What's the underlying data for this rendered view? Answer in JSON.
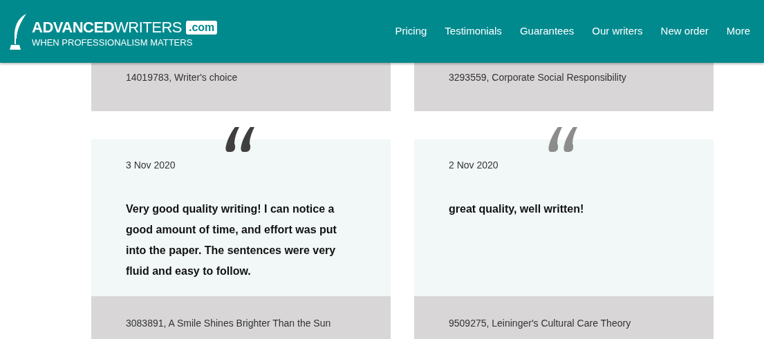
{
  "logo": {
    "name_bold": "ADVANCED",
    "name_light": "WRITERS",
    "domain": ".com",
    "tagline": "WHEN PROFESSIONALISM MATTERS"
  },
  "nav": [
    "Pricing",
    "Testimonials",
    "Guarantees",
    "Our writers",
    "New order",
    "More"
  ],
  "columns": [
    {
      "previous_order": "14019783, Writer's choice",
      "review": {
        "quote_active": true,
        "date": "3 Nov 2020",
        "text": "Very good quality writing! I can notice a good amount of time, and effort was put into the paper. The sentences were very fluid and easy to follow.",
        "order": "3083891, A Smile Shines Brighter Than the Sun"
      }
    },
    {
      "previous_order": "3293559, Corporate Social Responsibility",
      "review": {
        "quote_active": false,
        "date": "2 Nov 2020",
        "text": "great quality, well written!",
        "order": "9509275, Leininger's Cultural Care Theory"
      }
    }
  ]
}
